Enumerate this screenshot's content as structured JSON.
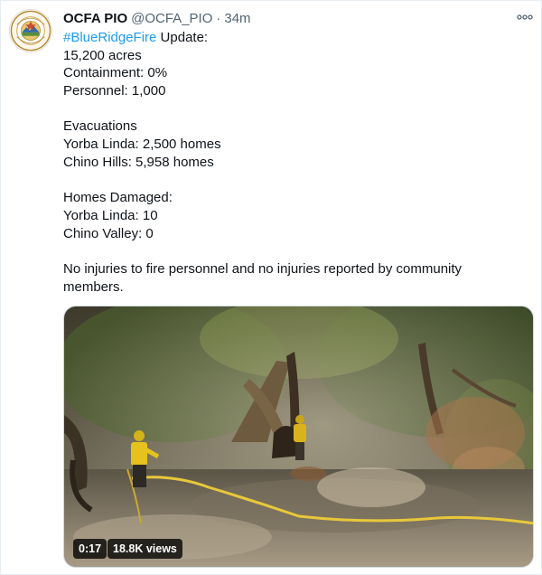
{
  "tweet": {
    "author": {
      "display_name": "OCFA PIO",
      "handle": "@OCFA_PIO",
      "avatar_icon": "ocfa-seal-logo",
      "avatar_text": "FIRE AUTHORITY"
    },
    "separator": "·",
    "time_ago": "34m",
    "more_icon": "more-dots-icon",
    "text": {
      "hashtag": "#BlueRidgeFire",
      "update_suffix": " Update:",
      "acres": "15,200 acres",
      "containment": "Containment: 0%",
      "personnel": "Personnel: 1,000",
      "evacuations_heading": "Evacuations",
      "evac_yorba_linda": "Yorba Linda: 2,500 homes",
      "evac_chino_hills": "Chino Hills: 5,958 homes",
      "damaged_heading": "Homes Damaged:",
      "damaged_yorba_linda": "Yorba Linda: 10",
      "damaged_chino_valley": "Chino Valley: 0",
      "injuries": "No injuries to fire personnel and no injuries reported by community members."
    },
    "video": {
      "duration": "0:17",
      "views": "18.8K views"
    }
  },
  "colors": {
    "link_blue": "#1d9bf0",
    "muted_gray": "#536471",
    "text_dark": "#0f1419",
    "hose_yellow": "#e8c83a",
    "firefighter_yellow": "#e6c21d"
  }
}
